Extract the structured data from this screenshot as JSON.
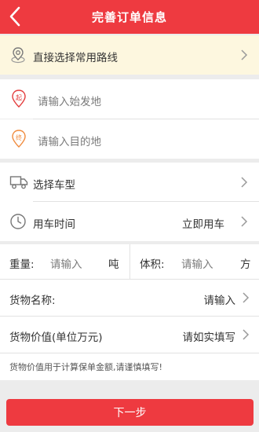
{
  "header": {
    "title": "完善订单信息"
  },
  "route": {
    "label": "直接选择常用路线"
  },
  "start": {
    "badge": "起",
    "placeholder": "请输入始发地"
  },
  "end": {
    "badge": "终",
    "placeholder": "请输入目的地"
  },
  "vehicle": {
    "label": "选择车型"
  },
  "time": {
    "label": "用车时间",
    "value": "立即用车"
  },
  "weight": {
    "label": "重量:",
    "placeholder": "请输入",
    "unit": "吨"
  },
  "volume": {
    "label": "体积:",
    "placeholder": "请输入",
    "unit": "方"
  },
  "goods_name": {
    "label": "货物名称:",
    "value": "请输入"
  },
  "goods_value": {
    "label": "货物价值(单位万元)",
    "value": "请如实填写"
  },
  "note": "货物价值用于计算保单金额,请谨慎填写!",
  "next_button": "下一步",
  "colors": {
    "accent": "#ee3a40",
    "route_bg": "#fdf7df",
    "page_bg": "#ececec"
  }
}
